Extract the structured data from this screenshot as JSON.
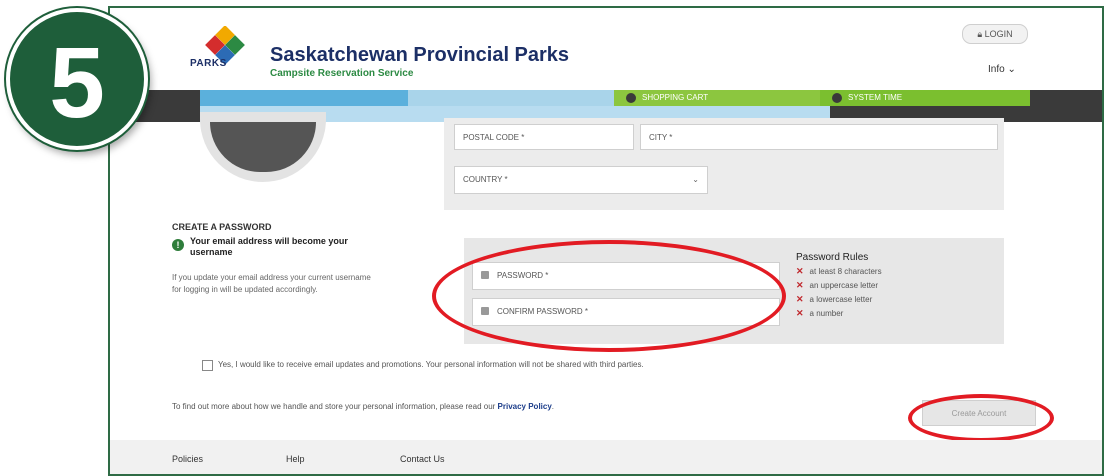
{
  "step": {
    "number": "5"
  },
  "header": {
    "logo_text": "PARKS",
    "title": "Saskatchewan Provincial Parks",
    "subtitle": "Campsite Reservation Service",
    "login_label": "LOGIN",
    "info_label": "Info ⌄"
  },
  "band": {
    "cart_label": "SHOPPING CART",
    "time_label": "SYSTEM TIME"
  },
  "address": {
    "postal_placeholder": "POSTAL CODE *",
    "city_placeholder": "CITY *",
    "country_placeholder": "COUNTRY *",
    "country_chevron": "⌄"
  },
  "password_section": {
    "title": "CREATE A PASSWORD",
    "info_icon": "!",
    "username_note": "Your email address will become your username",
    "update_note": "If you update your email address your current username for logging in will be updated accordingly.",
    "password_placeholder": "PASSWORD *",
    "confirm_placeholder": "CONFIRM PASSWORD *",
    "rules_title": "Password Rules",
    "rules": [
      "at least 8 characters",
      "an uppercase letter",
      "a lowercase letter",
      "a number"
    ],
    "rule_mark": "✕"
  },
  "consent": {
    "label": "Yes, I would like to receive email updates and promotions. Your personal information will not be shared with third parties."
  },
  "privacy": {
    "text": "To find out more about how we handle and store your personal information, please read our ",
    "link": "Privacy Policy",
    "end": "."
  },
  "actions": {
    "create_account": "Create Account"
  },
  "footer": {
    "links": [
      "Policies",
      "Help",
      "Contact Us"
    ]
  },
  "colors": {
    "annotation": "#e21b23",
    "badge": "#1e5e3a",
    "brand_blue": "#1c2f66",
    "brand_green": "#8cc63f"
  }
}
